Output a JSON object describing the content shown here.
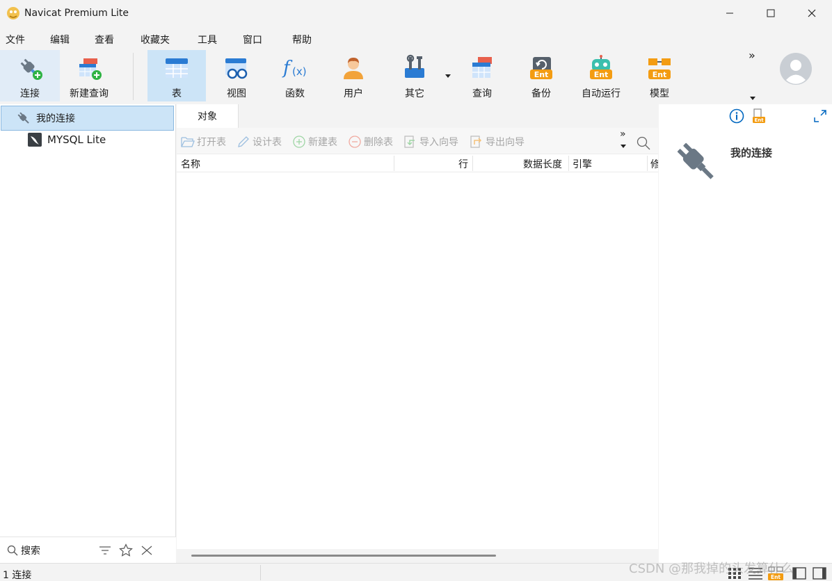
{
  "window": {
    "title": "Navicat Premium Lite"
  },
  "menu": [
    "文件",
    "编辑",
    "查看",
    "收藏夹",
    "工具",
    "窗口",
    "帮助"
  ],
  "toolbar": {
    "connect": "连接",
    "new_query": "新建查询",
    "table": "表",
    "view": "视图",
    "function": "函数",
    "user": "用户",
    "other": "其它",
    "query": "查询",
    "backup": "备份",
    "automation": "自动运行",
    "model": "模型",
    "overflow": "»"
  },
  "navigator": {
    "group": "我的连接",
    "connection": "MYSQL Lite",
    "search_label": "搜索"
  },
  "tabs": {
    "objects": "对象"
  },
  "object_toolbar": {
    "open_table": "打开表",
    "design_table": "设计表",
    "new_table": "新建表",
    "delete_table": "删除表",
    "import_wizard": "导入向导",
    "export_wizard": "导出向导",
    "overflow": "»"
  },
  "columns": {
    "name": "名称",
    "rows": "行",
    "data_length": "数据长度",
    "engine": "引擎",
    "modified": "修"
  },
  "info_panel": {
    "title": "我的连接",
    "ent_badge": "Ent"
  },
  "status": {
    "connections": "1 连接"
  },
  "watermark": "CSDN @那我掉的头发算什么",
  "colors": {
    "accent": "#0067c0",
    "selected_bg": "#cce4f7",
    "ent_orange": "#f39c12"
  }
}
